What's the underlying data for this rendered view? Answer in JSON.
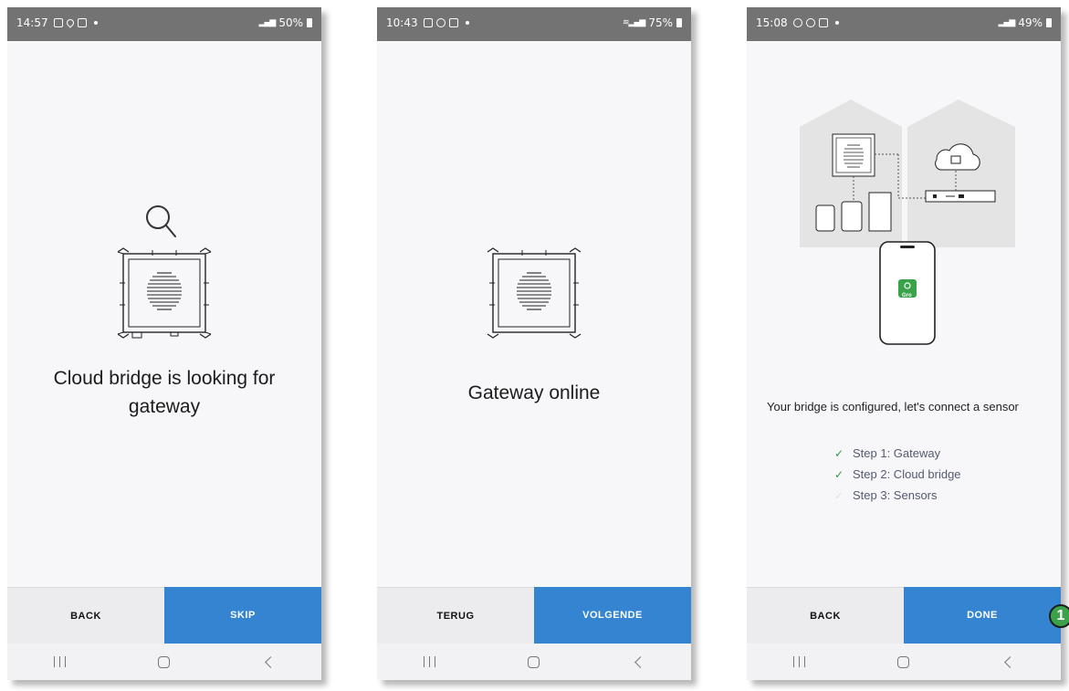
{
  "phones": [
    {
      "status": {
        "time": "14:57",
        "battery": "50%"
      },
      "title_lines": [
        "Cloud bridge is looking for",
        "gateway"
      ],
      "buttons": {
        "left": "BACK",
        "right": "SKIP"
      }
    },
    {
      "status": {
        "time": "10:43",
        "battery": "75%"
      },
      "title_lines": [
        "Gateway online"
      ],
      "buttons": {
        "left": "TERUG",
        "right": "VOLGENDE"
      }
    },
    {
      "status": {
        "time": "15:08",
        "battery": "49%"
      },
      "message": "Your bridge is configured, let's connect a sensor",
      "steps": [
        {
          "label": "Step 1: Gateway",
          "done": true
        },
        {
          "label": "Step 2: Cloud bridge",
          "done": true
        },
        {
          "label": "Step 3: Sensors",
          "done": false
        }
      ],
      "app_tile_label": "Gro",
      "buttons": {
        "left": "BACK",
        "right": "DONE"
      }
    }
  ],
  "badge": "1",
  "colors": {
    "primary": "#3484d2",
    "secondary": "#ececee",
    "statusbar": "#737373",
    "badge": "#3aa34a",
    "check": "#2e9a4a"
  },
  "icons": [
    "search-icon",
    "gateway-icon",
    "house-diagram",
    "cloud-icon",
    "smartphone-icon"
  ]
}
